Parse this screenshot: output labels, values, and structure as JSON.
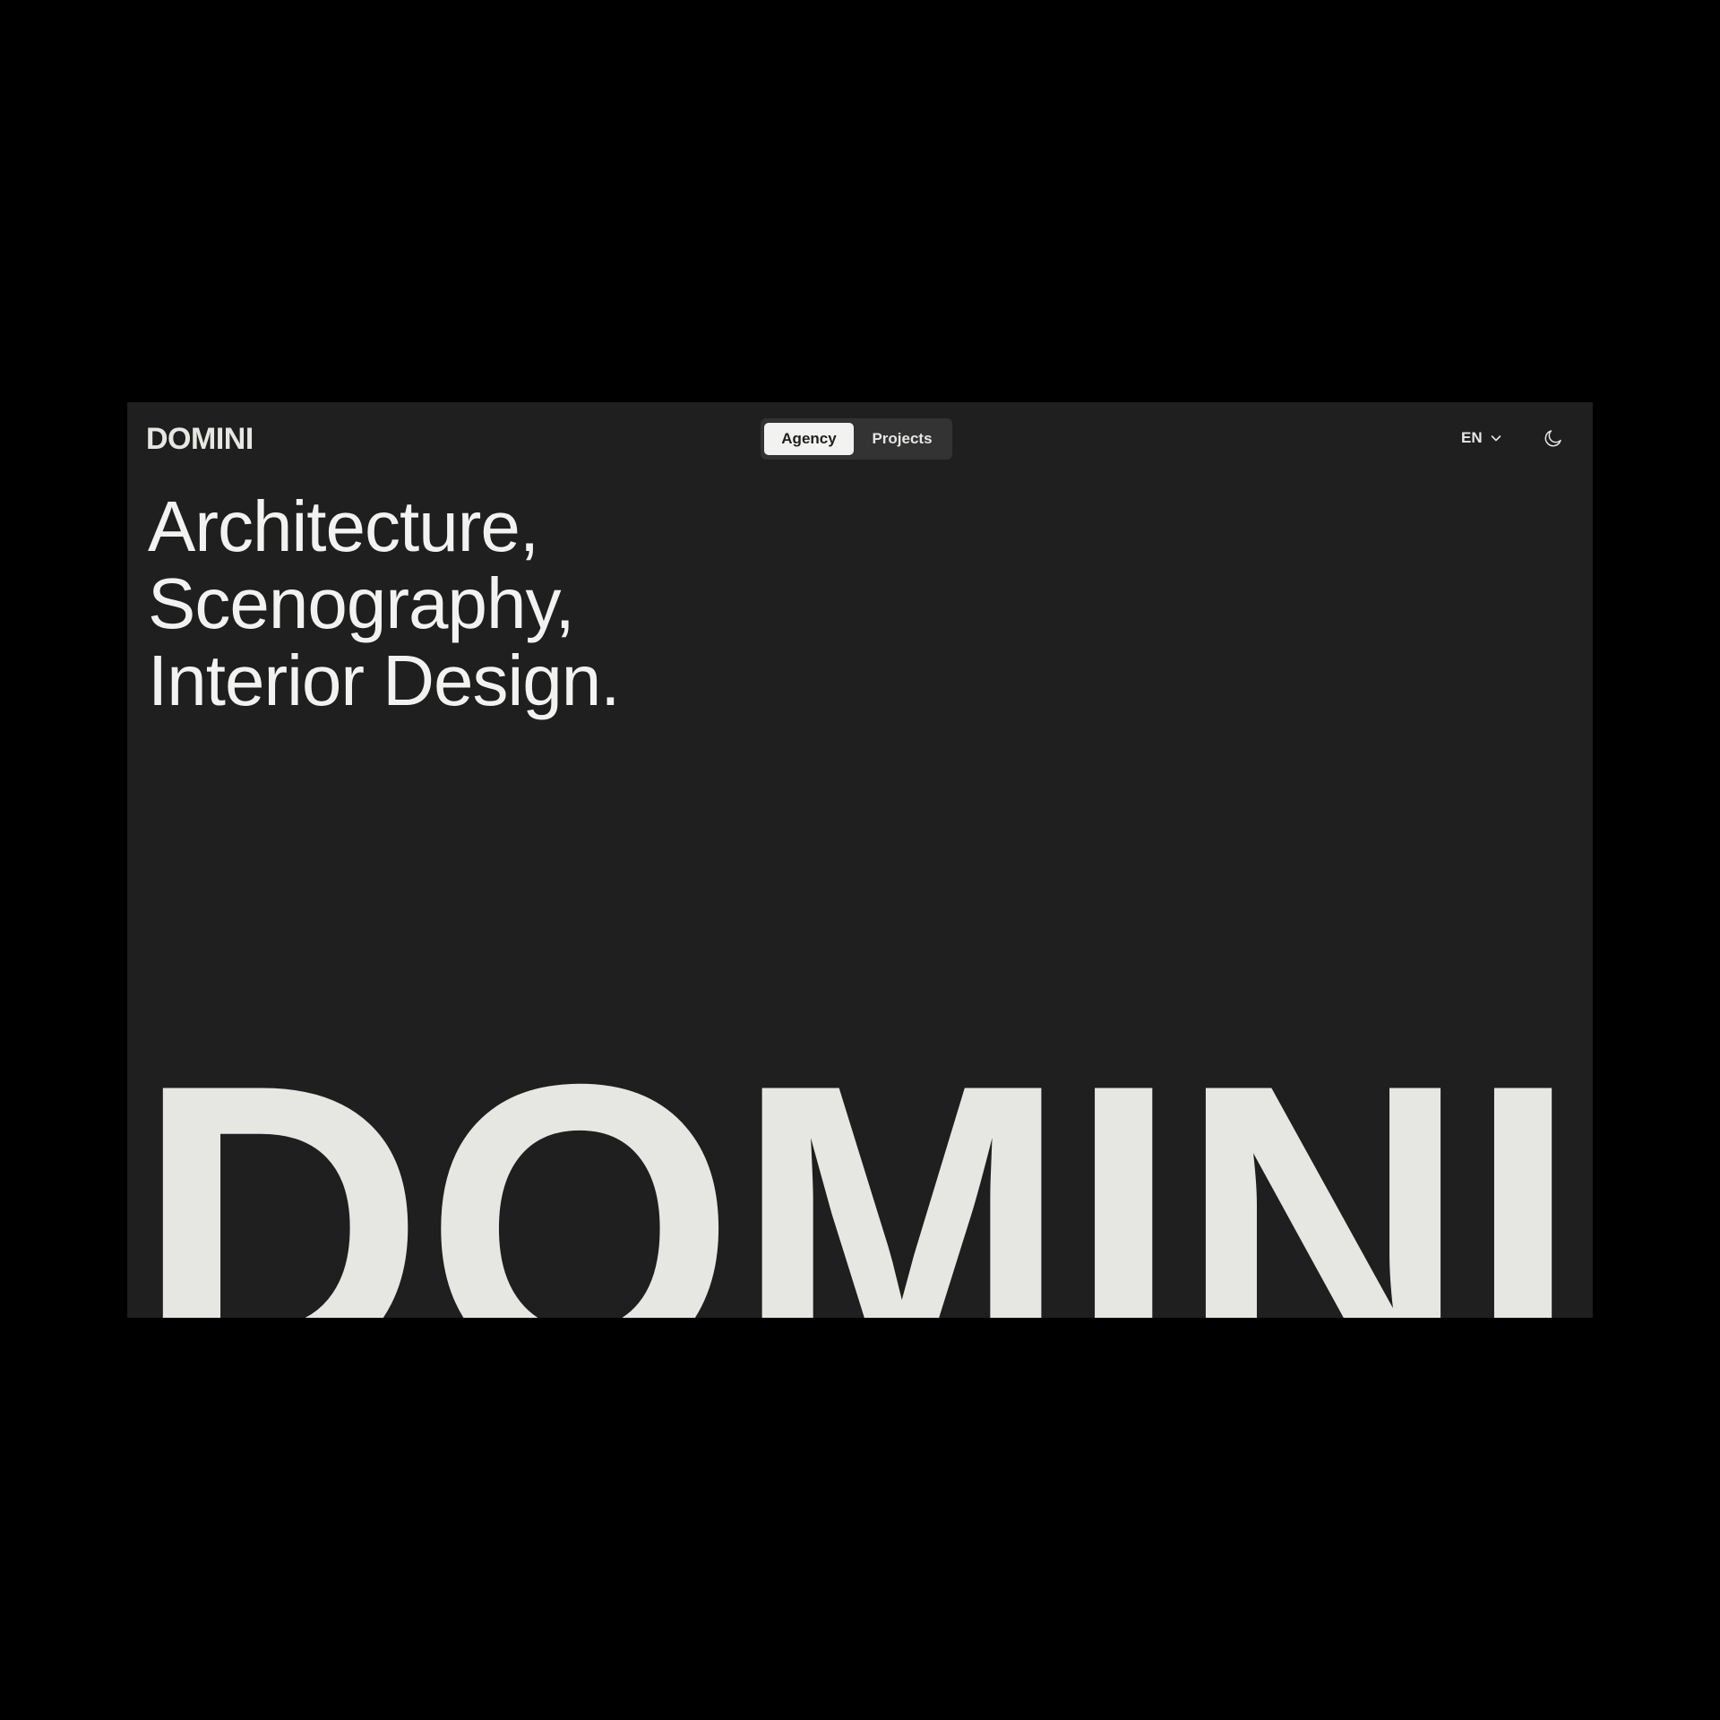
{
  "header": {
    "logo": "DOMINI",
    "nav": {
      "tabs": [
        {
          "label": "Agency",
          "active": true
        },
        {
          "label": "Projects",
          "active": false
        }
      ]
    },
    "language": {
      "selected": "EN",
      "icon": "chevron-down-icon"
    },
    "theme_toggle": {
      "icon": "moon-icon"
    }
  },
  "hero": {
    "headline_lines": [
      "Architecture,",
      "Scenography,",
      "Interior Design."
    ]
  },
  "wordmark": {
    "text": "DOMINI"
  },
  "colors": {
    "page_background": "#000000",
    "site_background": "#1f1f1f",
    "text_primary": "#f2f2f0",
    "wordmark": "#e6e6e3",
    "nav_track": "#333333",
    "nav_active_pill": "#f2f2f0"
  }
}
